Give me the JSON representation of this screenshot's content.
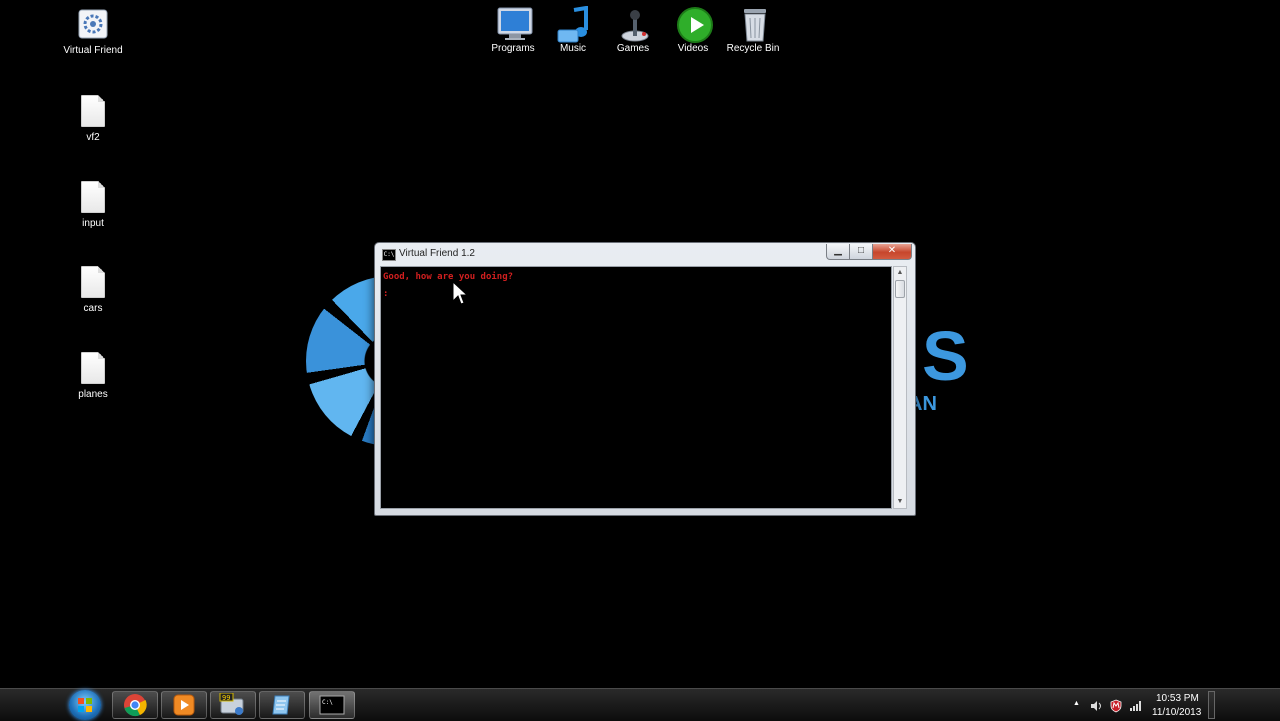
{
  "desktop": {
    "left_icons": [
      {
        "label": "Virtual Friend",
        "icon": "gear-app-icon"
      },
      {
        "label": "vf2",
        "icon": "text-file-icon"
      },
      {
        "label": "input",
        "icon": "text-file-icon"
      },
      {
        "label": "cars",
        "icon": "text-file-icon"
      },
      {
        "label": "planes",
        "icon": "text-file-icon"
      }
    ],
    "top_icons": [
      {
        "label": "Programs",
        "icon": "monitor-icon"
      },
      {
        "label": "Music",
        "icon": "music-note-icon"
      },
      {
        "label": "Games",
        "icon": "joystick-icon"
      },
      {
        "label": "Videos",
        "icon": "play-icon"
      },
      {
        "label": "Recycle Bin",
        "icon": "recycle-bin-icon"
      }
    ],
    "wallpaper": {
      "text_big": "S",
      "text_small": "AN",
      "accent": "#3c98df"
    }
  },
  "console_window": {
    "title": "Virtual Friend 1.2",
    "title_icon_text": "C:\\",
    "lines": [
      "Good, how are you doing?",
      ":"
    ],
    "text_color": "#d11f1f",
    "controls": {
      "minimize": "▁",
      "maximize": "□",
      "close": "✕"
    }
  },
  "taskbar": {
    "pinned": [
      {
        "name": "chrome",
        "icon": "chrome-icon"
      },
      {
        "name": "media-player",
        "icon": "media-player-icon"
      },
      {
        "name": "app-99",
        "icon": "system-app-icon",
        "badge": "99"
      },
      {
        "name": "notes",
        "icon": "notepad-icon"
      },
      {
        "name": "cmd",
        "icon": "console-icon",
        "label": "C:\\"
      }
    ],
    "clock": {
      "time": "10:53 PM",
      "date": "11/10/2013"
    },
    "tray_arrow": "▲"
  }
}
